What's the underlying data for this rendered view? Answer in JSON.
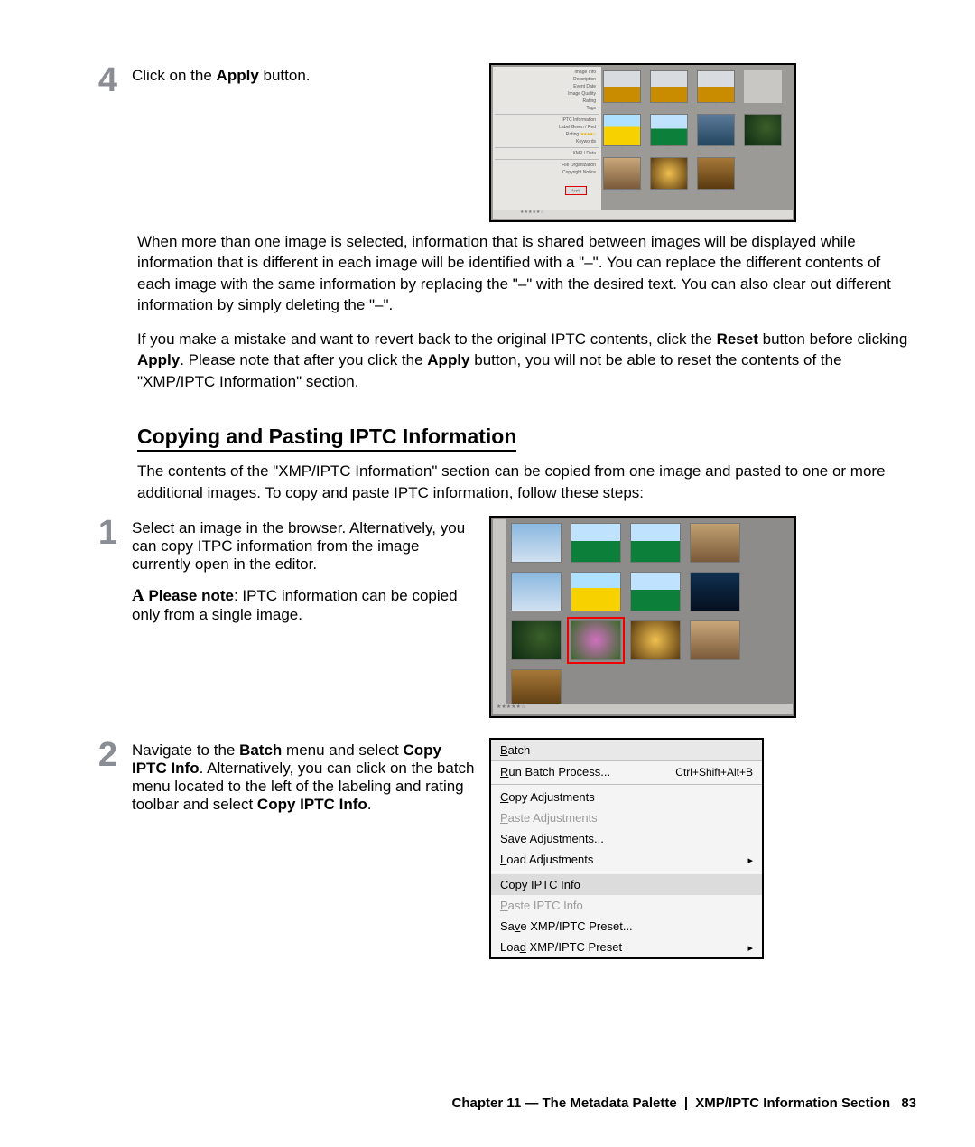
{
  "step4": {
    "num": "4",
    "text_pre": "Click on the ",
    "text_bold": "Apply",
    "text_post": " button."
  },
  "shot1_panel": {
    "l1": "Image Info",
    "l2": "Description",
    "l3": "Event Date",
    "l4": "Image Quality",
    "l5": "Rating",
    "l6": "Tags",
    "l7": "IPTC Information",
    "l8": "Label   Green / Red",
    "l9": "Rating",
    "stars": "★★★★☆",
    "l10": "Keywords",
    "l11": "XMP / Data",
    "l12": "File Organization",
    "l13": "Copyright Notice",
    "apply": "Apply"
  },
  "bottom_stars": "★★★★★☆",
  "para1": "When more than one image is selected, information that is shared between images will be displayed while information that is different in each image will be identified with a \"–\". You can replace the different contents of each image with the same information by replacing the \"–\" with the desired text. You can also clear out different information by simply deleting the \"–\".",
  "para2_pre": "If you make a mistake and want to revert back to the original IPTC contents, click the ",
  "para2_b1": "Reset",
  "para2_mid": " button before clicking ",
  "para2_b2": "Apply",
  "para2_mid2": ". Please note that after you click the ",
  "para2_b3": "Apply",
  "para2_post": " button, you will not be able to reset the contents of the \"XMP/IPTC Information\" section.",
  "h2": "Copying and Pasting IPTC Information",
  "h2_intro": "The contents of the \"XMP/IPTC Information\" section can be copied from one image and pasted to one or more additional images. To copy and paste IPTC information, follow these steps:",
  "step1": {
    "num": "1",
    "text": "Select an image in the browser. Alternatively, you can copy ITPC information from the image currently open in the editor.",
    "note_b": "Please note",
    "note_rest": ": IPTC information can be copied only from a single image."
  },
  "step2": {
    "num": "2",
    "pre": "Navigate to the ",
    "b1": "Batch",
    "mid1": " menu and select ",
    "b2": "Copy IPTC Info",
    "mid2": ". Alternatively, you can click on the batch menu located to the left of the labeling and rating toolbar and select ",
    "b3": "Copy IPTC Info",
    "post": "."
  },
  "menu": {
    "title_u": "B",
    "title_rest": "atch",
    "items": [
      {
        "u": "R",
        "label": "un Batch Process...",
        "sc": "Ctrl+Shift+Alt+B",
        "arrow": false,
        "disabled": false,
        "hl": false
      },
      null,
      {
        "u": "C",
        "label": "opy Adjustments",
        "sc": "",
        "arrow": false,
        "disabled": false,
        "hl": false
      },
      {
        "u": "P",
        "label": "aste Adjustments",
        "sc": "",
        "arrow": false,
        "disabled": true,
        "hl": false
      },
      {
        "u": "S",
        "label": "ave Adjustments...",
        "sc": "",
        "arrow": false,
        "disabled": false,
        "hl": false
      },
      {
        "u": "L",
        "label": "oad Adjustments",
        "sc": "",
        "arrow": true,
        "disabled": false,
        "hl": false
      },
      null,
      {
        "u": "",
        "label": "Copy IPTC Info",
        "sc": "",
        "arrow": false,
        "disabled": false,
        "hl": true
      },
      {
        "u": "P",
        "label": "aste IPTC Info",
        "sc": "",
        "arrow": false,
        "disabled": true,
        "hl": false
      },
      {
        "u": "",
        "label": "Sa",
        "u2": "v",
        "label2": "e XMP/IPTC Preset...",
        "sc": "",
        "arrow": false,
        "disabled": false,
        "hl": false
      },
      {
        "u": "",
        "label": "Loa",
        "u2": "d",
        "label2": " XMP/IPTC Preset",
        "sc": "",
        "arrow": true,
        "disabled": false,
        "hl": false
      }
    ]
  },
  "footer": {
    "chapter": "Chapter 11 — The Metadata Palette",
    "section": "XMP/IPTC Information Section",
    "page": "83"
  }
}
